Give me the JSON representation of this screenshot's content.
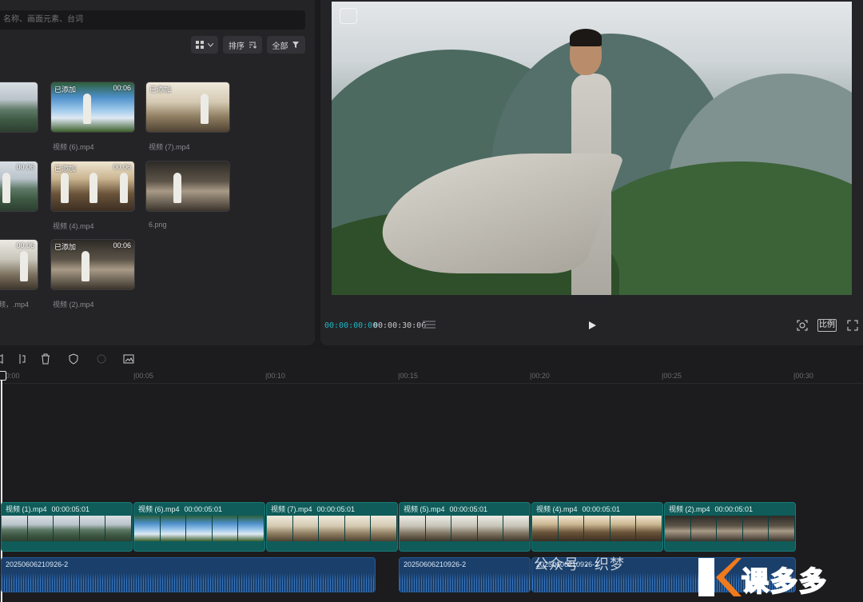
{
  "media": {
    "search_placeholder": "名称、画面元素、台词",
    "sort_label": "排序",
    "filter_label": "全部",
    "items": [
      {
        "tag": "",
        "duration": "",
        "name": ""
      },
      {
        "tag": "已添加",
        "duration": "00:06",
        "name": "视频 (6).mp4"
      },
      {
        "tag": "已添加",
        "duration": "",
        "name": "视频 (7).mp4"
      },
      {
        "tag": "",
        "duration": "00:06",
        "name": ""
      },
      {
        "tag": "已添加",
        "duration": "00:06",
        "name": "视频 (4).mp4"
      },
      {
        "tag": "",
        "duration": "",
        "name": "6.png"
      },
      {
        "tag": "",
        "duration": "00:06",
        "name": "频，.mp4"
      },
      {
        "tag": "已添加",
        "duration": "00:06",
        "name": "视频 (2).mp4"
      }
    ]
  },
  "preview": {
    "current_time": "00:00:00:00",
    "total_time": "00:00:30:06",
    "ratio_label": "比例"
  },
  "timeline": {
    "ruler": [
      "00:00",
      "|00:05",
      "|00:10",
      "|00:15",
      "|00:20",
      "|00:25",
      "|00:30"
    ],
    "clips": [
      {
        "name": "视频 (1).mp4",
        "duration": "00:00:05:01"
      },
      {
        "name": "视频 (6).mp4",
        "duration": "00:00:05:01"
      },
      {
        "name": "视频 (7).mp4",
        "duration": "00:00:05:01"
      },
      {
        "name": "视频 (5).mp4",
        "duration": "00:00:05:01"
      },
      {
        "name": "视频 (4).mp4",
        "duration": "00:00:05:01"
      },
      {
        "name": "视频 (2).mp4",
        "duration": "00:00:05:01"
      }
    ],
    "audio": [
      {
        "name": "20250606210926-2"
      },
      {
        "name": "20250606210926-2"
      },
      {
        "name": "20250606210926-2"
      }
    ]
  },
  "watermark": {
    "text": "公众号 · 织梦",
    "logo_text": "课多多"
  },
  "colors": {
    "accent": "#1fb6c1",
    "clip": "#0f5c5a",
    "audio": "#1a3f6b"
  }
}
